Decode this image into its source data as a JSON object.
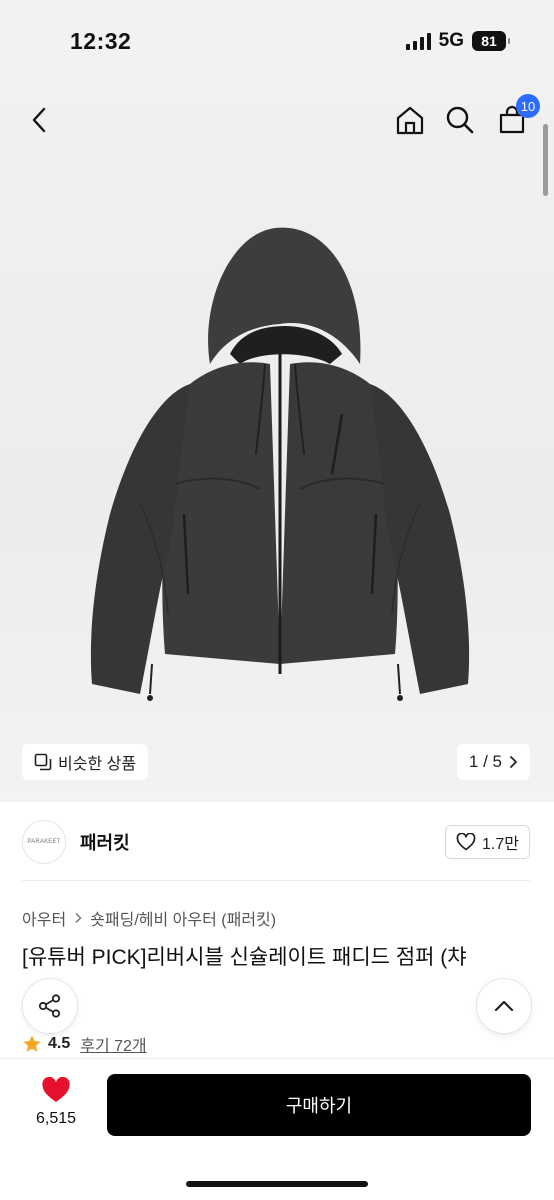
{
  "status_bar": {
    "time": "12:32",
    "network": "5G",
    "battery": "81"
  },
  "header": {
    "cart_count": "10"
  },
  "hero": {
    "similar_label": "비슷한 상품",
    "page_indicator": "1 / 5"
  },
  "brand": {
    "logo_text": "PARAKEET",
    "name": "패러킷",
    "likes": "1.7만"
  },
  "breadcrumb": {
    "category": "아우터",
    "subcategory": "숏패딩/헤비 아우터 (패러킷)"
  },
  "product": {
    "title": "[유튜버 PICK]리버시블 신슐레이트 패디드 점퍼 (챠",
    "rating": "4.5",
    "reviews_label": "후기 72개"
  },
  "bottom_bar": {
    "wish_count": "6,515",
    "buy_label": "구매하기"
  },
  "colors": {
    "accent_blue": "#2e6bff",
    "heart_red": "#e8112d",
    "star_yellow": "#f5a623",
    "jacket": "#3a3b3d"
  },
  "icons": [
    "back-icon",
    "home-icon",
    "search-icon",
    "cart-icon",
    "similar-icon",
    "chevron-right-icon",
    "heart-outline-icon",
    "share-icon",
    "chevron-up-icon",
    "star-icon",
    "heart-filled-icon"
  ]
}
